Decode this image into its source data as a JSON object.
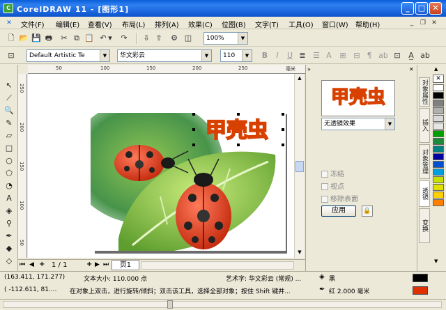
{
  "window": {
    "title": "CorelDRAW 11 - [图形1]",
    "min": "_",
    "max": "□",
    "close": "✕"
  },
  "menubar": {
    "items": [
      "文件(F)",
      "编辑(E)",
      "查看(V)",
      "布局(L)",
      "排列(A)",
      "效果(C)",
      "位图(B)",
      "文字(T)",
      "工具(O)",
      "窗口(W)",
      "帮助(H)"
    ]
  },
  "toolbar": {
    "zoom": "100%"
  },
  "propertybar": {
    "text_style": "Default Artistic Te",
    "font_name": "华文彩云",
    "font_size": "110",
    "bold": "B",
    "italic": "I",
    "underline": "U",
    "ab": "ab"
  },
  "ruler": {
    "h_ticks": [
      "50",
      "100",
      "150",
      "200",
      "250",
      "毫米"
    ],
    "v_ticks": [
      "250",
      "200",
      "150",
      "100",
      "50"
    ]
  },
  "canvas": {
    "art_text": "甲壳虫"
  },
  "docker": {
    "preview_text": "甲壳虫",
    "lens_type": "无透镜效果",
    "options": [
      "冻结",
      "视点",
      "移除表面"
    ],
    "apply_label": "应用"
  },
  "docktabs": [
    "对象属性",
    "插入",
    "对象管理",
    "透镜",
    "变换"
  ],
  "palette": [
    "#FFFFFF",
    "#000000",
    "#7F7F7F",
    "#B0B0B0",
    "#D8D8D8",
    "#E5E5E5",
    "#00A000",
    "#1B8A3A",
    "#008080",
    "#0000A0",
    "#0050D0",
    "#00A0E0",
    "#C8E000",
    "#E0E000",
    "#FFD000",
    "#FF8000"
  ],
  "pagebar": {
    "page_pos": "1 / 1",
    "page_tab": "页1"
  },
  "status": {
    "coords1": "(163.411, 171.277)",
    "info1": "文本大小: 110.000 点",
    "object": "艺术字: 华文彩云 (常规) ...",
    "fill_label": "黑",
    "coords2": "( -112.611, 81....",
    "hint": "在对象上双击，进行旋转/倾斜；双击该工具，选择全部对象；按住 Shift 键并...",
    "outline_label": "红  2.000 毫米"
  },
  "colors": {
    "title_bar": "#0A5FD8",
    "fill_swatch": "#000000",
    "outline_swatch": "#E03000",
    "art_text": "#F05A10"
  }
}
